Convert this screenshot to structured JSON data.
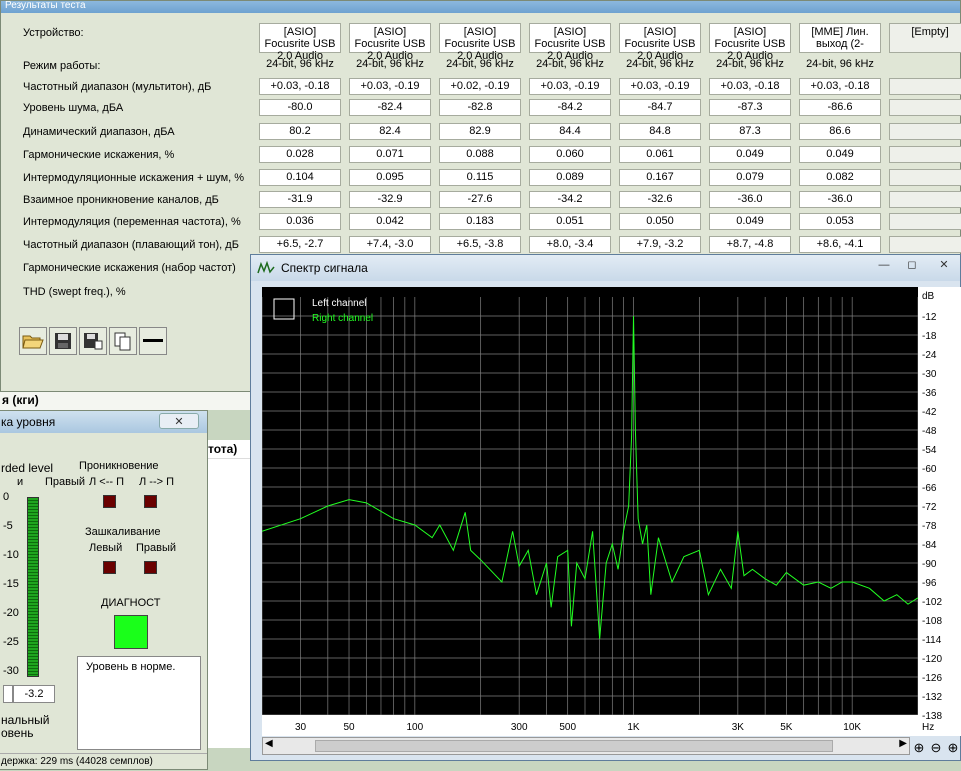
{
  "main_window": {
    "title": "Результаты теста",
    "device_label": "Устройство:",
    "devices": [
      "[ASIO] Focusrite USB 2.0 Audio",
      "[ASIO] Focusrite USB 2.0 Audio",
      "[ASIO] Focusrite USB 2.0 Audio",
      "[ASIO] Focusrite USB 2.0 Audio",
      "[ASIO] Focusrite USB 2.0 Audio",
      "[ASIO] Focusrite USB 2.0 Audio",
      "[MME] Лин. выход (2-",
      "[Empty]"
    ],
    "rows": [
      {
        "label": "Режим работы:",
        "values": [
          "24-bit, 96 kHz",
          "24-bit, 96 kHz",
          "24-bit, 96 kHz",
          "24-bit, 96 kHz",
          "24-bit, 96 kHz",
          "24-bit, 96 kHz",
          "24-bit, 96 kHz"
        ],
        "plain": true
      },
      {
        "label": "Частотный диапазон (мультитон), дБ",
        "values": [
          "+0.03, -0.18",
          "+0.03, -0.19",
          "+0.02, -0.19",
          "+0.03, -0.19",
          "+0.03, -0.19",
          "+0.03, -0.18",
          "+0.03, -0.18"
        ]
      },
      {
        "label": "Уровень шума, дБА",
        "values": [
          "-80.0",
          "-82.4",
          "-82.8",
          "-84.2",
          "-84.7",
          "-87.3",
          "-86.6"
        ]
      },
      {
        "label": "Динамический диапазон, дБА",
        "values": [
          "80.2",
          "82.4",
          "82.9",
          "84.4",
          "84.8",
          "87.3",
          "86.6"
        ]
      },
      {
        "label": "Гармонические искажения, %",
        "values": [
          "0.028",
          "0.071",
          "0.088",
          "0.060",
          "0.061",
          "0.049",
          "0.049"
        ]
      },
      {
        "label": "Интермодуляционные искажения + шум, %",
        "values": [
          "0.104",
          "0.095",
          "0.115",
          "0.089",
          "0.167",
          "0.079",
          "0.082"
        ]
      },
      {
        "label": "Взаимное проникновение каналов, дБ",
        "values": [
          "-31.9",
          "-32.9",
          "-27.6",
          "-34.2",
          "-32.6",
          "-36.0",
          "-36.0"
        ]
      },
      {
        "label": "Интермодуляция (переменная частота), %",
        "values": [
          "0.036",
          "0.042",
          "0.183",
          "0.051",
          "0.050",
          "0.049",
          "0.053"
        ]
      },
      {
        "label": "Частотный диапазон (плавающий тон), дБ",
        "values": [
          "+6.5, -2.7",
          "+7.4, -3.0",
          "+6.5, -3.8",
          "+8.0, -3.4",
          "+7.9, -3.2",
          "+8.7, -4.8",
          "+8.6, -4.1"
        ]
      },
      {
        "label": "Гармонические искажения (набор частот)",
        "values": []
      },
      {
        "label": "THD (swept freq.), %",
        "values": []
      }
    ],
    "toolbar": [
      "open-icon",
      "save-icon",
      "save-as-icon",
      "copy-icon",
      "minus-icon"
    ]
  },
  "bg_fragments": {
    "a": "я (кги)",
    "b": "тота)"
  },
  "level_window": {
    "title": "ка уровня",
    "recorded_level": "rded level",
    "right_label": "Правый",
    "scale": [
      "0",
      "-5",
      "-10",
      "-15",
      "-20",
      "-25",
      "-30"
    ],
    "level_value": "-3.2",
    "bottom_text_1": "нальный",
    "bottom_text_2": "овень",
    "status_bar": "держка: 229 ms (44028 семплов)",
    "crosstalk_title": "Проникновение",
    "crosstalk_lr": "Л <-- П",
    "crosstalk_rl": "Л --> П",
    "clip_title": "Зашкаливание",
    "clip_left": "Левый",
    "clip_right": "Правый",
    "diag_title": "ДИАГНОСТ",
    "diag_message": "Уровень в норме."
  },
  "spectrum_window": {
    "title": "Спектр сигнала",
    "legend_left": "Left channel",
    "legend_right": "Right channel",
    "y_unit": "dB",
    "x_unit": "Hz",
    "colors": {
      "left": "#ffffff",
      "right": "#22ff22",
      "grid": "#808080"
    }
  },
  "chart_data": {
    "type": "line",
    "xscale": "log",
    "xlim": [
      20,
      20000
    ],
    "ylim": [
      -138,
      -6
    ],
    "x_ticks": [
      30,
      50,
      100,
      300,
      500,
      1000,
      3000,
      5000,
      10000
    ],
    "x_tick_labels": [
      "30",
      "50",
      "100",
      "300",
      "500",
      "1K",
      "3K",
      "5K",
      "10K"
    ],
    "y_ticks": [
      -12,
      -18,
      -24,
      -30,
      -36,
      -42,
      -48,
      -54,
      -60,
      -66,
      -72,
      -78,
      -84,
      -90,
      -96,
      -102,
      -108,
      -114,
      -120,
      -126,
      -132,
      -138
    ],
    "series": [
      {
        "name": "Right channel",
        "color": "#22ff22",
        "x": [
          20,
          30,
          40,
          50,
          60,
          80,
          100,
          120,
          130,
          150,
          170,
          180,
          200,
          250,
          280,
          300,
          330,
          360,
          400,
          420,
          450,
          500,
          520,
          550,
          600,
          650,
          700,
          750,
          800,
          850,
          900,
          950,
          980,
          1000,
          1020,
          1050,
          1100,
          1150,
          1200,
          1300,
          1500,
          1700,
          2000,
          2200,
          2500,
          2800,
          3000,
          3200,
          3500,
          4000,
          4500,
          5000,
          6000,
          7000,
          8000,
          9000,
          10000,
          12000,
          14000,
          16000,
          18000,
          20000
        ],
        "y": [
          -80,
          -76,
          -72,
          -70,
          -71,
          -76,
          -78,
          -82,
          -78,
          -86,
          -74,
          -86,
          -89,
          -96,
          -80,
          -91,
          -86,
          -100,
          -90,
          -104,
          -88,
          -86,
          -110,
          -90,
          -95,
          -80,
          -114,
          -90,
          -84,
          -92,
          -80,
          -72,
          -50,
          -12,
          -48,
          -76,
          -84,
          -78,
          -100,
          -82,
          -96,
          -88,
          -86,
          -100,
          -92,
          -98,
          -80,
          -94,
          -92,
          -95,
          -97,
          -93,
          -97,
          -96,
          -98,
          -96,
          -96,
          -98,
          -102,
          -100,
          -103,
          -101
        ]
      }
    ]
  }
}
